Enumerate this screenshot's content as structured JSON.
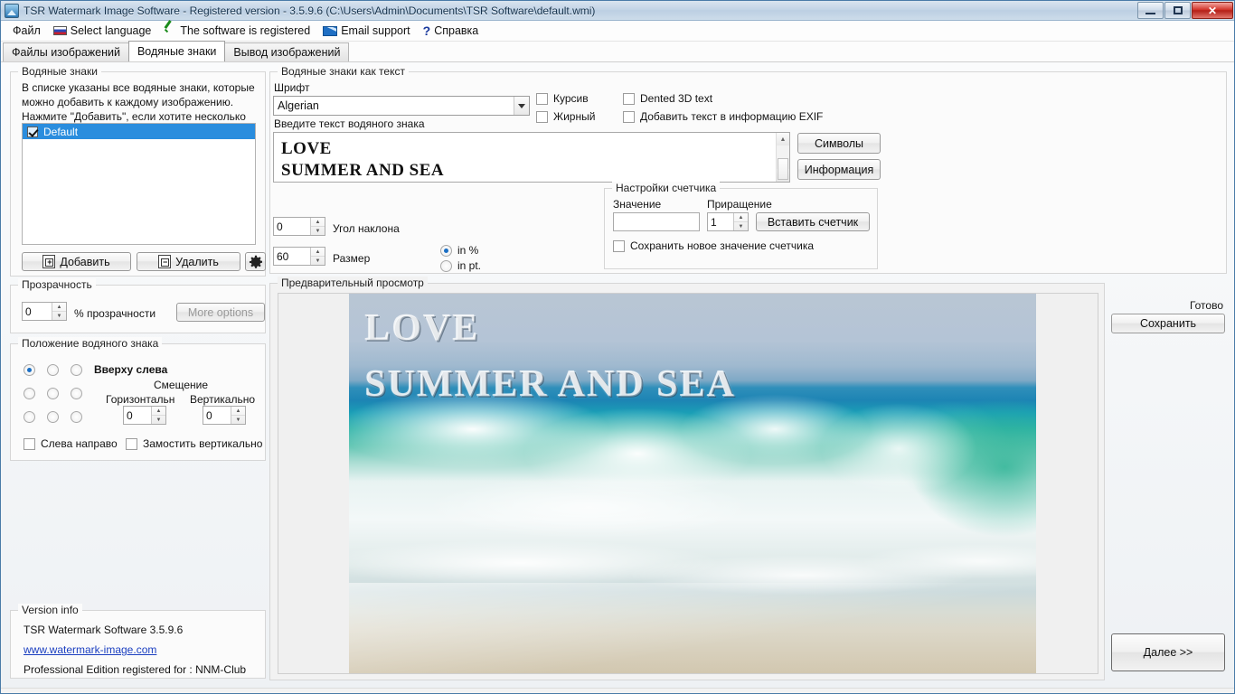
{
  "window": {
    "title": "TSR Watermark Image Software - Registered version - 3.5.9.6 (C:\\Users\\Admin\\Documents\\TSR Software\\default.wmi)",
    "app_icon": "image-icon",
    "minimize": "—",
    "maximize": "□",
    "close": "✕"
  },
  "menu": {
    "items": [
      {
        "label": "Файл",
        "icon": "none"
      },
      {
        "label": "Select language",
        "icon": "flag-russia-icon"
      },
      {
        "label": "The software is registered",
        "icon": "green-check-icon"
      },
      {
        "label": "Email support",
        "icon": "envelope-icon"
      },
      {
        "label": "Справка",
        "icon": "question-mark-icon"
      }
    ]
  },
  "tabs": [
    {
      "label": "Файлы изображений",
      "active": false
    },
    {
      "label": "Водяные знаки",
      "active": true
    },
    {
      "label": "Вывод изображений",
      "active": false
    }
  ],
  "watermarks_panel": {
    "legend": "Водяные знаки",
    "description_line1": "В списке указаны все водяные знаки, которые",
    "description_line2": "можно добавить к каждому изображению.",
    "description_line3": "Нажмите \"Добавить\", если хотите несколько",
    "list_items": [
      {
        "label": "Default",
        "checked": true,
        "selected": true
      }
    ],
    "add_button": "Добавить",
    "delete_button": "Удалить",
    "settings_button_icon": "gear-icon",
    "selection_color": "#2a8dde"
  },
  "transparency_panel": {
    "legend": "Прозрачность",
    "value": "0",
    "label": "% прозрачности",
    "more_options_button": "More options"
  },
  "position_panel": {
    "legend": "Положение водяного знака",
    "selected_position_label": "Вверху слева",
    "selected_index": 0,
    "offset_title": "Смещение",
    "horizontal_label": "Горизонтальн",
    "horizontal_value": "0",
    "vertical_label": "Вертикально",
    "vertical_value": "0",
    "checkbox_lr": "Слева направо",
    "checkbox_lr_checked": false,
    "checkbox_tile": "Замостить вертикально",
    "checkbox_tile_checked": false
  },
  "version_panel": {
    "legend": "Version info",
    "product": "TSR Watermark Software 3.5.9.6",
    "link": "www.watermark-image.com",
    "registered_for": "Professional Edition registered for : NNM-Club"
  },
  "text_watermark_panel": {
    "legend": "Водяные знаки как текст",
    "font_label": "Шрифт",
    "font_value": "Algerian",
    "italic_label": "Курсив",
    "italic_checked": false,
    "bold_label": "Жирный",
    "bold_checked": false,
    "dented_label": "Dented 3D text",
    "dented_checked": false,
    "exif_label": "Добавить текст в информацию EXIF",
    "exif_checked": false,
    "text_input_label": "Введите текст водяного знака",
    "text_line1": "LOVE",
    "text_line2": "SUMMER AND SEA",
    "symbols_button": "Символы",
    "info_button": "Информация",
    "angle_value": "0",
    "angle_label": "Угол наклона",
    "size_value": "60",
    "size_label": "Размер",
    "unit_percent": "in %",
    "unit_points": "in pt.",
    "unit_selected": "in %"
  },
  "counter_panel": {
    "legend": "Настройки счетчика",
    "value_label": "Значение",
    "value": "",
    "increment_label": "Приращение",
    "increment_value": "1",
    "insert_button": "Вставить счетчик",
    "save_checkbox": "Сохранить новое значение счетчика",
    "save_checkbox_checked": false
  },
  "preview_panel": {
    "legend": "Предварительный просмотр",
    "watermark_line1": "LOVE",
    "watermark_line2": "SUMMER AND SEA",
    "image_description": "ocean wave breaking on sandy beach"
  },
  "right_panel": {
    "status": "Готово",
    "save_button": "Сохранить",
    "next_button": "Далее >>"
  }
}
